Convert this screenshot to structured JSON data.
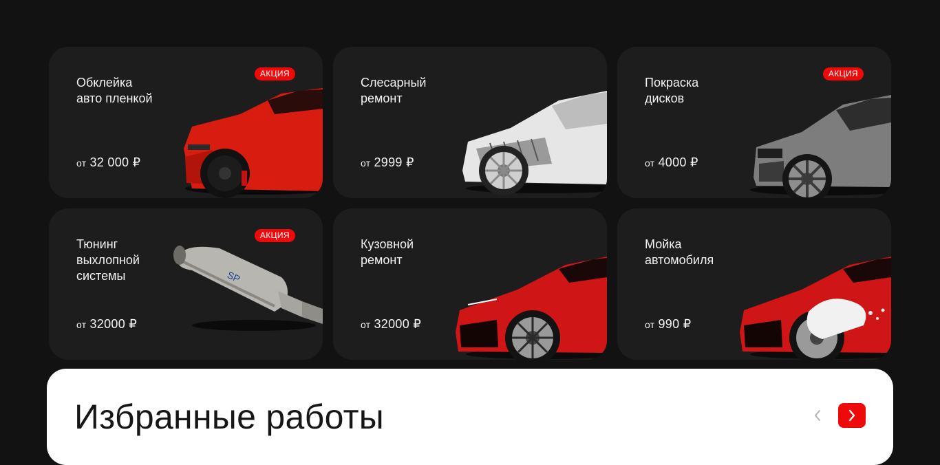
{
  "services": [
    {
      "title": "Обклейка\nавто пленкой",
      "price_prefix": "от",
      "price": "32 000 ₽",
      "badge": "АКЦИЯ",
      "image": "red-suv-front"
    },
    {
      "title": "Слесарный\nремонт",
      "price_prefix": "от",
      "price": "2999 ₽",
      "badge": "",
      "image": "xray-suv"
    },
    {
      "title": "Покраска\nдисков",
      "price_prefix": "от",
      "price": "4000 ₽",
      "badge": "АКЦИЯ",
      "image": "grey-suv-front"
    },
    {
      "title": "Тюнинг\nвыхлопной системы",
      "price_prefix": "от",
      "price": "32000 ₽",
      "badge": "АКЦИЯ",
      "image": "exhaust-muffler"
    },
    {
      "title": "Кузовной\nремонт",
      "price_prefix": "от",
      "price": "32000 ₽",
      "badge": "",
      "image": "red-sedan-front"
    },
    {
      "title": "Мойка\nавтомобиля",
      "price_prefix": "от",
      "price": "990 ₽",
      "badge": "",
      "image": "red-sedan-foam"
    }
  ],
  "works": {
    "title": "Избранные работы",
    "prev_icon": "chevron-left-icon",
    "next_icon": "chevron-right-icon"
  },
  "colors": {
    "background": "#121212",
    "card": "#1d1d1d",
    "accent": "#ee0a0a",
    "text_light": "#f2f2f2",
    "text_dark": "#161616"
  }
}
